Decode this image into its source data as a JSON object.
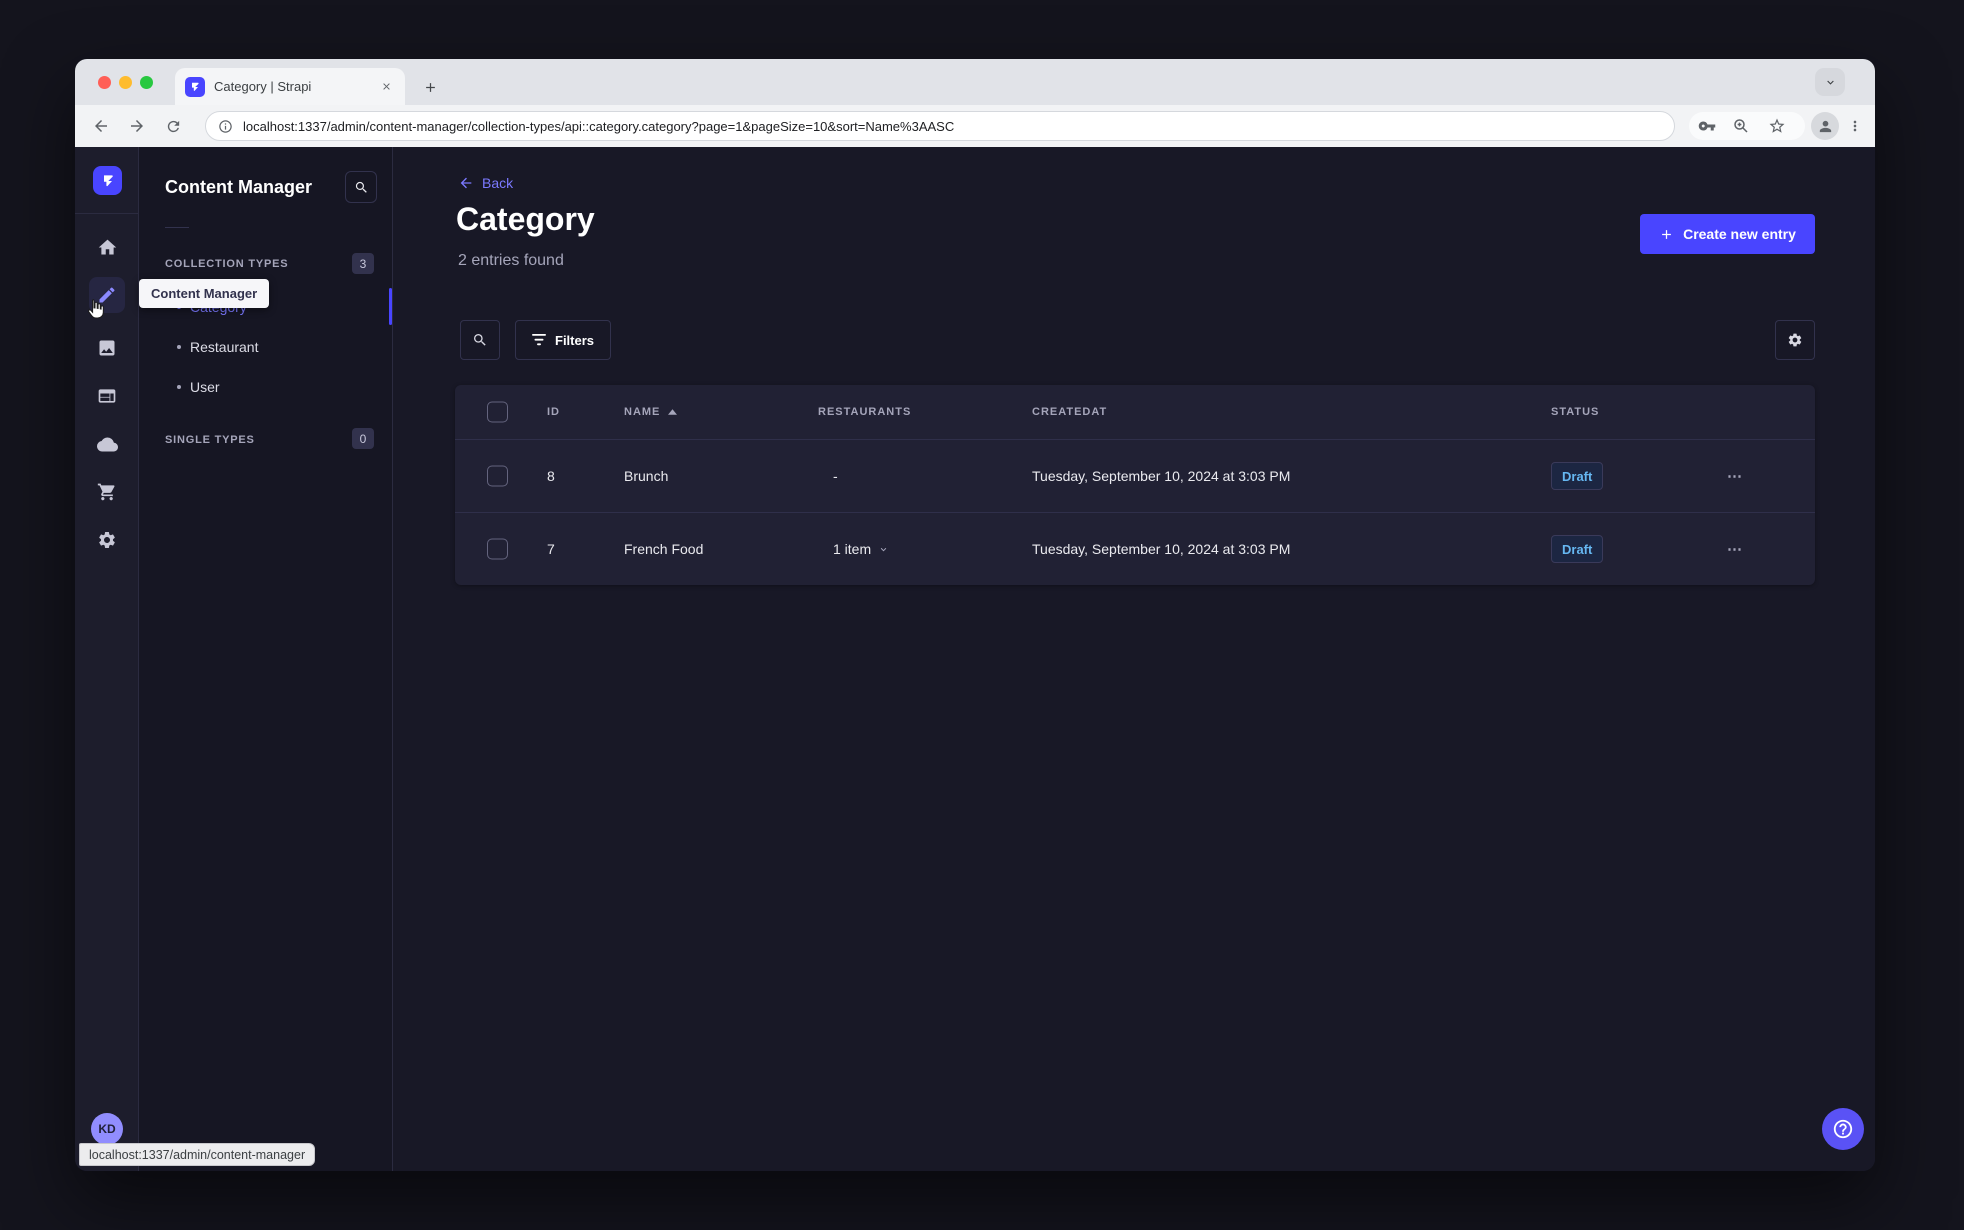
{
  "browser": {
    "tab_title": "Category | Strapi",
    "url": "localhost:1337/admin/content-manager/collection-types/api::category.category?page=1&pageSize=10&sort=Name%3AASC",
    "status_link": "localhost:1337/admin/content-manager",
    "new_tab_glyph": "+"
  },
  "rail": {
    "avatar_initials": "KD"
  },
  "subnav": {
    "title": "Content Manager",
    "collection_types_label": "COLLECTION TYPES",
    "collection_types_count": "3",
    "items": [
      {
        "label": "Category"
      },
      {
        "label": "Restaurant"
      },
      {
        "label": "User"
      }
    ],
    "single_types_label": "SINGLE TYPES",
    "single_types_count": "0",
    "tooltip": "Content Manager"
  },
  "header": {
    "back_label": "Back",
    "title": "Category",
    "subtitle": "2 entries found",
    "create_button_label": "Create new entry"
  },
  "filters": {
    "filters_label": "Filters"
  },
  "table": {
    "headers": {
      "id": "ID",
      "name": "NAME",
      "restaurants": "RESTAURANTS",
      "createdat": "CREATEDAT",
      "status": "STATUS"
    },
    "sort": {
      "column": "NAME",
      "direction": "ascending"
    },
    "rows": [
      {
        "id": "8",
        "name": "Brunch",
        "restaurants": "-",
        "created_at": "Tuesday, September 10, 2024 at 3:03 PM",
        "status": "Draft",
        "has_relation_toggle": false
      },
      {
        "id": "7",
        "name": "French Food",
        "restaurants": "1 item",
        "created_at": "Tuesday, September 10, 2024 at 3:03 PM",
        "status": "Draft",
        "has_relation_toggle": true
      }
    ],
    "more_glyph": "⋯"
  },
  "colors": {
    "accent": "#4945FF",
    "accent_light": "#7B79FF",
    "app_bg": "#181826",
    "card_bg": "#212134",
    "muted_text": "#A5A5BA",
    "draft_text": "#66B7F1"
  }
}
